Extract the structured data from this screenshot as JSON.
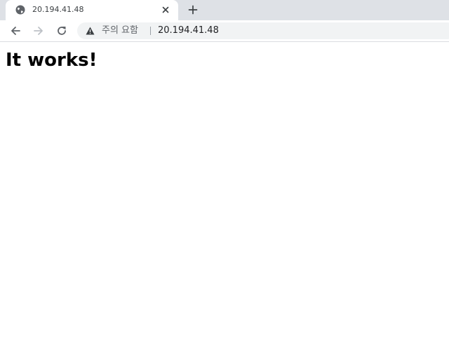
{
  "browser": {
    "tab": {
      "title": "20.194.41.48",
      "favicon_icon": "globe-icon",
      "close_icon": "close-icon"
    },
    "new_tab_icon": "plus-icon",
    "nav": {
      "back_icon": "arrow-left-icon",
      "forward_icon": "arrow-right-icon",
      "reload_icon": "reload-icon"
    },
    "omnibox": {
      "security_icon": "warning-icon",
      "security_label": "주의 요함",
      "url": "20.194.41.48"
    },
    "colors": {
      "tabstrip": "#dee1e6",
      "omnibox": "#f1f3f4",
      "icon": "#5f6368",
      "icon_disabled": "#bdc1c6"
    }
  },
  "page": {
    "heading": "It works!"
  }
}
